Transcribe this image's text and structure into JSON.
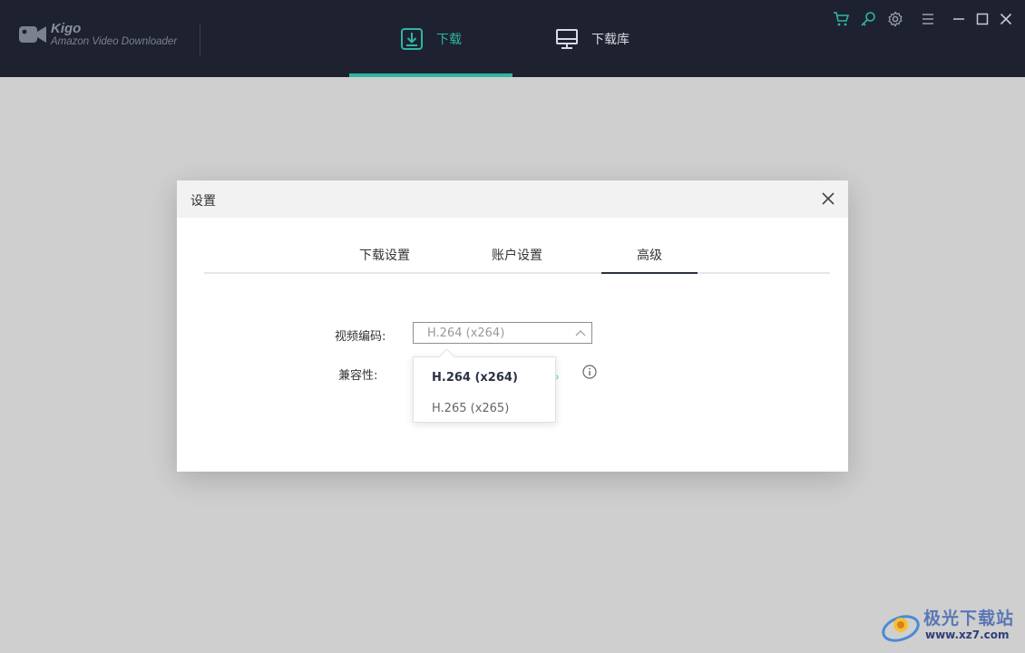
{
  "app": {
    "name": "Kigo",
    "subtitle": "Amazon Video Downloader"
  },
  "nav": {
    "download_label": "下载",
    "library_label": "下载库"
  },
  "window_icons": [
    "cart-icon",
    "key-icon",
    "gear-icon",
    "menu-icon",
    "minimize-icon",
    "maximize-icon",
    "close-icon"
  ],
  "dialog": {
    "title": "设置",
    "tabs": [
      {
        "label": "下载设置"
      },
      {
        "label": "账户设置"
      },
      {
        "label": "高级",
        "active": true
      }
    ],
    "codec_label": "视频编码:",
    "codec_value": "H.264 (x264)",
    "compat_label": "兼容性:",
    "compat_tail": "。",
    "dropdown_options": [
      "H.264 (x264)",
      "H.265 (x265)"
    ]
  },
  "watermark": {
    "text": "极光下载站",
    "url": "www.xz7.com"
  },
  "colors": {
    "accent": "#2eb5a3",
    "titlebar": "#1e2230",
    "backdrop": "#cfcfcf"
  }
}
